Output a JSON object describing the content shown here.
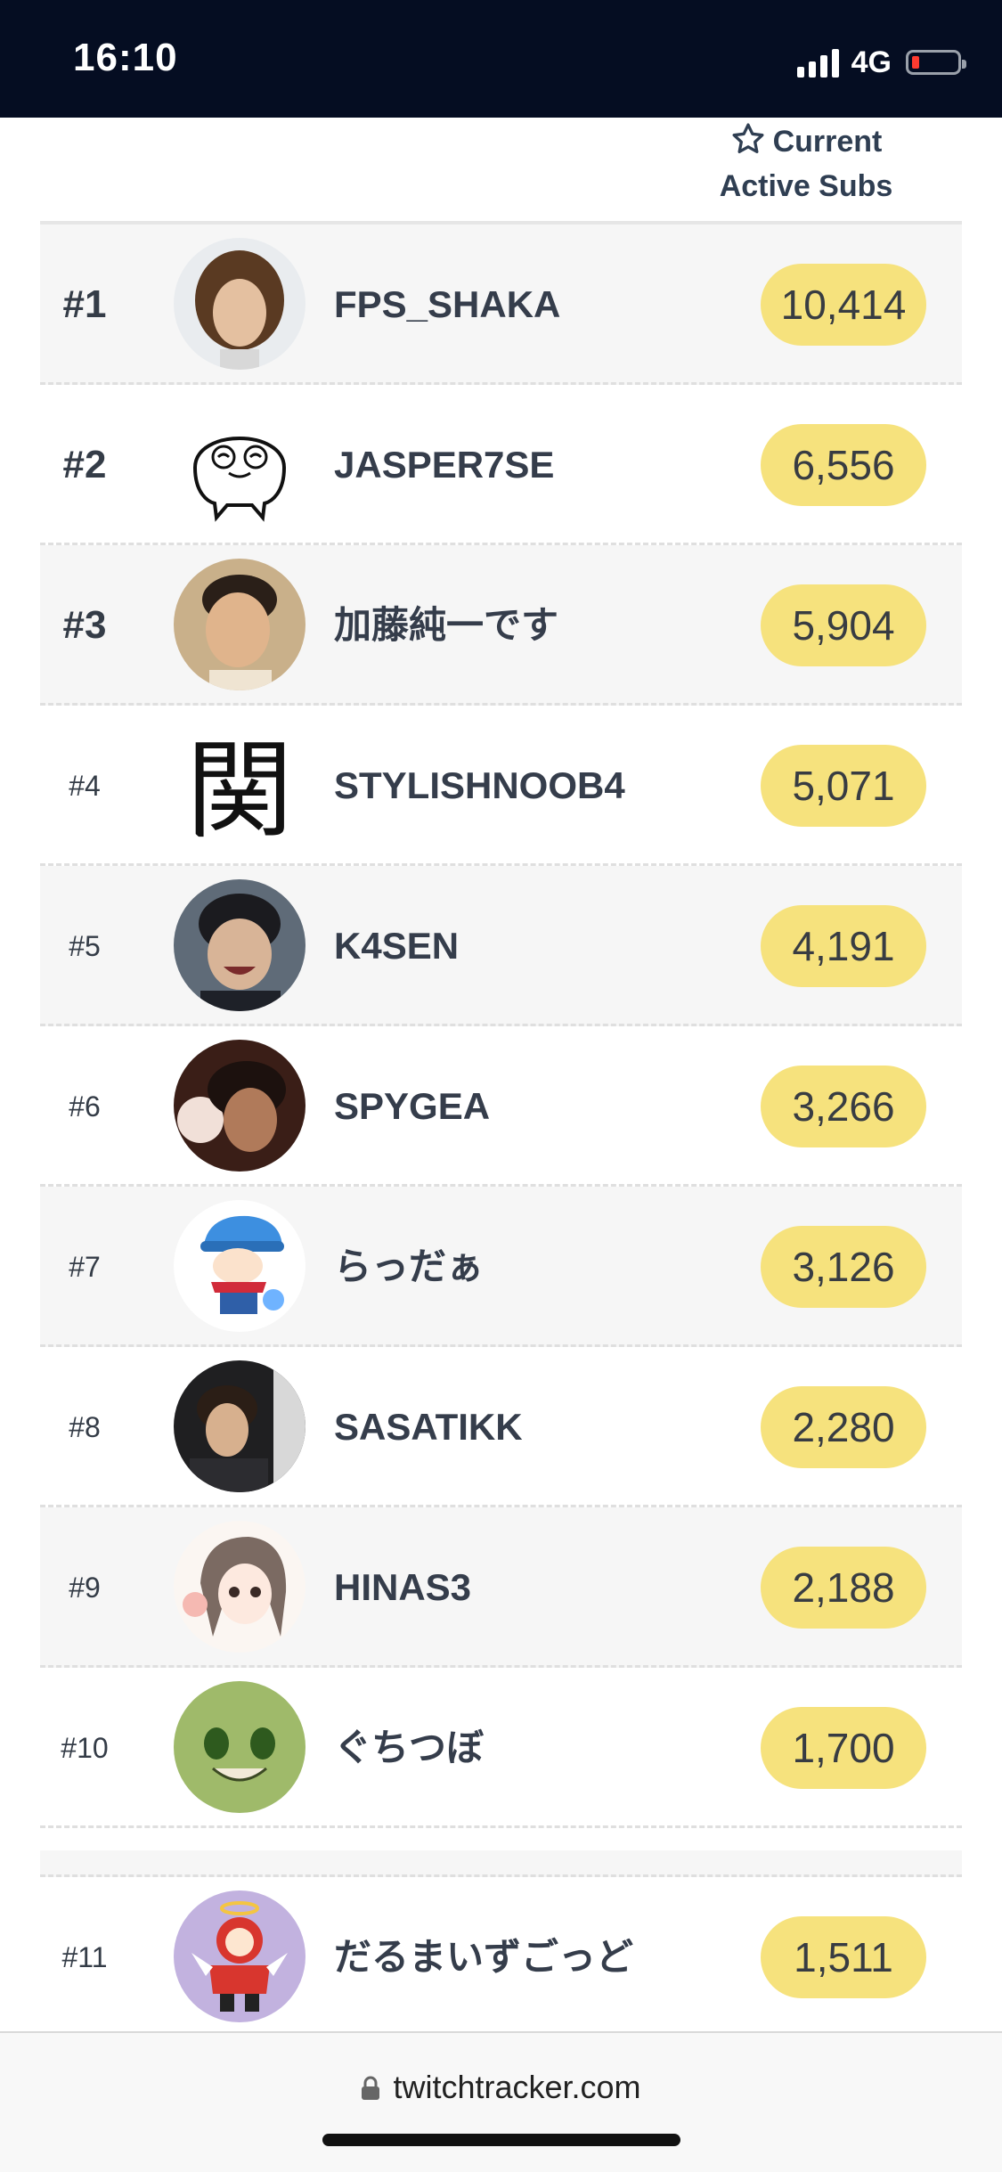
{
  "status_bar": {
    "time": "16:10",
    "network": "4G",
    "battery_color": "#ff3b30"
  },
  "header": {
    "column_title_line1": "Current",
    "column_title_line2": "Active Subs"
  },
  "rows": [
    {
      "rank": "#1",
      "name": "FPS_SHAKA",
      "subs": "10,414",
      "avatar": "avatar-photo-1"
    },
    {
      "rank": "#2",
      "name": "JASPER7SE",
      "subs": "6,556",
      "avatar": "avatar-cartoon-face"
    },
    {
      "rank": "#3",
      "name": "加藤純一です",
      "subs": "5,904",
      "avatar": "avatar-photo-3"
    },
    {
      "rank": "#4",
      "name": "STYLISHNOOB4",
      "subs": "5,071",
      "avatar": "avatar-kanji"
    },
    {
      "rank": "#5",
      "name": "K4SEN",
      "subs": "4,191",
      "avatar": "avatar-photo-5"
    },
    {
      "rank": "#6",
      "name": "SPYGEA",
      "subs": "3,266",
      "avatar": "avatar-photo-6"
    },
    {
      "rank": "#7",
      "name": "らっだぁ",
      "subs": "3,126",
      "avatar": "avatar-blue-cap-character"
    },
    {
      "rank": "#8",
      "name": "SASATIKK",
      "subs": "2,280",
      "avatar": "avatar-photo-8"
    },
    {
      "rank": "#9",
      "name": "HINAS3",
      "subs": "2,188",
      "avatar": "avatar-anime-girl"
    },
    {
      "rank": "#10",
      "name": "ぐちつぼ",
      "subs": "1,700",
      "avatar": "avatar-green-face"
    },
    {
      "rank": "#11",
      "name": "だるまいずごっど",
      "subs": "1,511",
      "avatar": "avatar-red-hoodie-character"
    }
  ],
  "url_bar": {
    "domain": "twitchtracker.com"
  },
  "colors": {
    "pill": "#f6e27d",
    "row_shade": "#f6f6f6",
    "status_bar": "#050d22"
  }
}
